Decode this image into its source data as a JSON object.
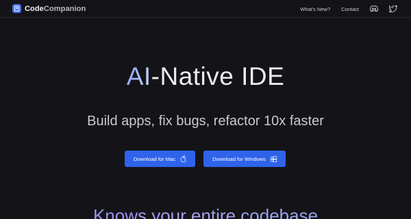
{
  "nav": {
    "brand_part1": "Code",
    "brand_part2": "Companion",
    "links": [
      "What's New?",
      "Contact"
    ],
    "icons": [
      "discord-icon",
      "twitter-icon"
    ]
  },
  "hero": {
    "title_accent": "AI",
    "title_rest": "-Native IDE",
    "subtitle": "Build apps, fix bugs, refactor 10x faster"
  },
  "buttons": {
    "mac_label": "Download for Mac",
    "windows_label": "Download for Windows"
  },
  "section": {
    "heading": "Knows your entire codebase"
  },
  "colors": {
    "background": "#141418",
    "accent": "#2f63ea",
    "heading_gradient_start": "#8d84f0"
  }
}
